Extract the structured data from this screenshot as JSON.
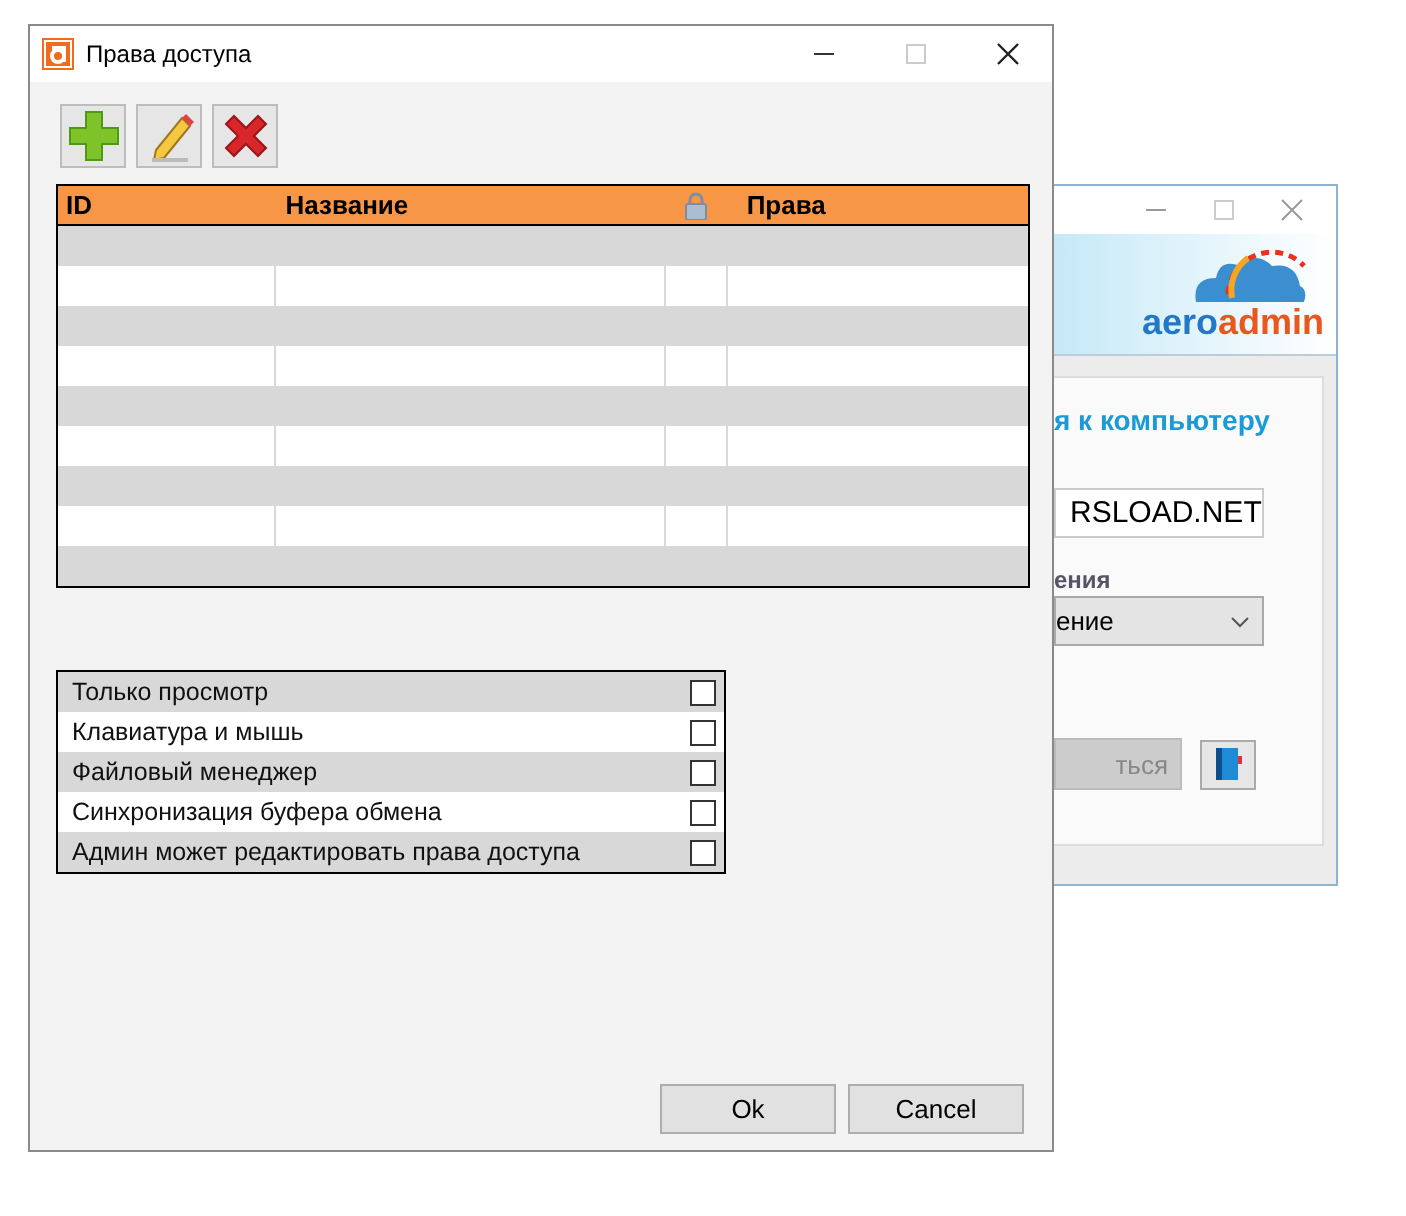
{
  "background_window": {
    "logo": {
      "part_1": "aero",
      "part_2": "admin"
    },
    "heading": "я к компьютеру",
    "id_field": {
      "value": "RSLOAD.NET"
    },
    "mode_label": "ения",
    "mode_select": {
      "value": "ение"
    },
    "connect_button": {
      "label": "ться",
      "disabled": true
    }
  },
  "window": {
    "title": "Права доступа"
  },
  "toolbar": [
    {
      "kind": "add"
    },
    {
      "kind": "edit"
    },
    {
      "kind": "delete"
    }
  ],
  "table": {
    "columns": [
      {
        "kind": "text",
        "label": "ID"
      },
      {
        "kind": "text",
        "label": "Название"
      },
      {
        "kind": "lock"
      },
      {
        "kind": "text",
        "label": "Права"
      }
    ]
  },
  "permissions": [
    {
      "label": "Только просмотр",
      "checked": false
    },
    {
      "label": "Клавиатура и мышь",
      "checked": false
    },
    {
      "label": "Файловый менеджер",
      "checked": false
    },
    {
      "label": "Синхронизация буфера обмена",
      "checked": false
    },
    {
      "label": "Админ может редактировать права доступа",
      "checked": false
    }
  ],
  "buttons": [
    "Ok",
    "Cancel"
  ]
}
